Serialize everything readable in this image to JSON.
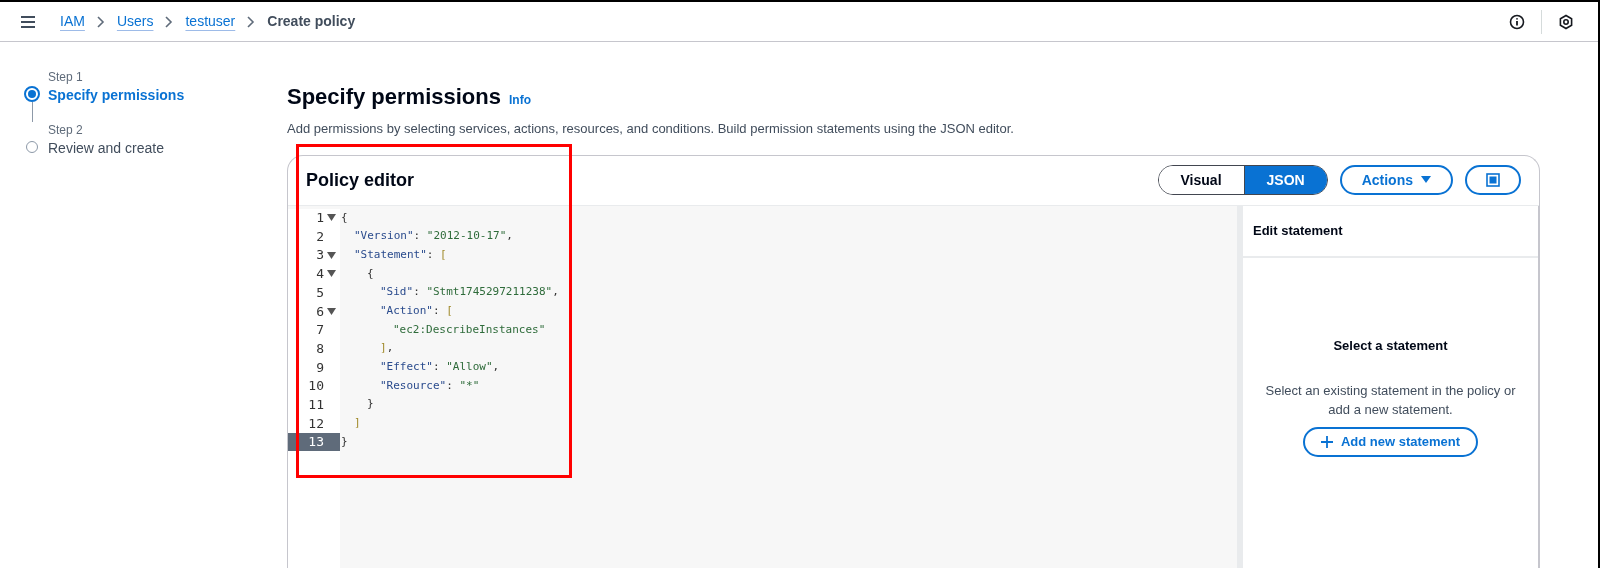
{
  "breadcrumb": [
    {
      "label": "IAM",
      "link": true
    },
    {
      "label": "Users",
      "link": true
    },
    {
      "label": "testuser",
      "link": true
    },
    {
      "label": "Create policy",
      "link": false
    }
  ],
  "steps": [
    {
      "step": "Step 1",
      "label": "Specify permissions",
      "selected": true
    },
    {
      "step": "Step 2",
      "label": "Review and create",
      "selected": false
    }
  ],
  "page": {
    "title": "Specify permissions",
    "info": "Info",
    "description": "Add permissions by selecting services, actions, resources, and conditions. Build permission statements using the JSON editor."
  },
  "editor": {
    "title": "Policy editor",
    "modes": [
      {
        "label": "Visual",
        "selected": false
      },
      {
        "label": "JSON",
        "selected": true
      }
    ],
    "actions": "Actions",
    "lines": [
      {
        "number": "1",
        "foldable": true,
        "selected": false,
        "tokens": [
          {
            "kind": "brace-open",
            "text": "{"
          }
        ]
      },
      {
        "number": "2",
        "foldable": false,
        "selected": false,
        "tokens": [
          {
            "kind": "key",
            "text": "\"Version\""
          },
          {
            "kind": "punct",
            "text": ": "
          },
          {
            "kind": "string",
            "text": "\"2012-10-17\""
          },
          {
            "kind": "punct",
            "text": ","
          }
        ]
      },
      {
        "number": "3",
        "foldable": true,
        "selected": false,
        "tokens": [
          {
            "kind": "key",
            "text": "\"Statement\""
          },
          {
            "kind": "punct",
            "text": ": "
          },
          {
            "kind": "bracket-open",
            "text": "["
          }
        ]
      },
      {
        "number": "4",
        "foldable": true,
        "selected": false,
        "tokens": [
          {
            "kind": "brace-open",
            "text": "{"
          }
        ]
      },
      {
        "number": "5",
        "foldable": false,
        "selected": false,
        "tokens": [
          {
            "kind": "key",
            "text": "\"Sid\""
          },
          {
            "kind": "punct",
            "text": ": "
          },
          {
            "kind": "string",
            "text": "\"Stmt1745297211238\""
          },
          {
            "kind": "punct",
            "text": ","
          }
        ]
      },
      {
        "number": "6",
        "foldable": true,
        "selected": false,
        "tokens": [
          {
            "kind": "key",
            "text": "\"Action\""
          },
          {
            "kind": "punct",
            "text": ": "
          },
          {
            "kind": "bracket-open",
            "text": "["
          }
        ]
      },
      {
        "number": "7",
        "foldable": false,
        "selected": false,
        "tokens": [
          {
            "kind": "string",
            "text": "\"ec2:DescribeInstances\""
          }
        ]
      },
      {
        "number": "8",
        "foldable": false,
        "selected": false,
        "tokens": [
          {
            "kind": "bracket-close",
            "text": "]"
          },
          {
            "kind": "punct",
            "text": ","
          }
        ]
      },
      {
        "number": "9",
        "foldable": false,
        "selected": false,
        "tokens": [
          {
            "kind": "key",
            "text": "\"Effect\""
          },
          {
            "kind": "punct",
            "text": ": "
          },
          {
            "kind": "string",
            "text": "\"Allow\""
          },
          {
            "kind": "punct",
            "text": ","
          }
        ]
      },
      {
        "number": "10",
        "foldable": false,
        "selected": false,
        "tokens": [
          {
            "kind": "key",
            "text": "\"Resource\""
          },
          {
            "kind": "punct",
            "text": ": "
          },
          {
            "kind": "string",
            "text": "\"*\""
          }
        ]
      },
      {
        "number": "11",
        "foldable": false,
        "selected": false,
        "tokens": [
          {
            "kind": "brace-close",
            "text": "}"
          }
        ]
      },
      {
        "number": "12",
        "foldable": false,
        "selected": false,
        "tokens": [
          {
            "kind": "bracket-close",
            "text": "]"
          }
        ]
      },
      {
        "number": "13",
        "foldable": false,
        "selected": true,
        "tokens": [
          {
            "kind": "brace-close",
            "text": "}"
          }
        ]
      }
    ],
    "panel": {
      "title": "Edit statement",
      "heading": "Select a statement",
      "text": "Select an existing statement in the policy or add a new statement.",
      "button": "Add new statement"
    }
  }
}
